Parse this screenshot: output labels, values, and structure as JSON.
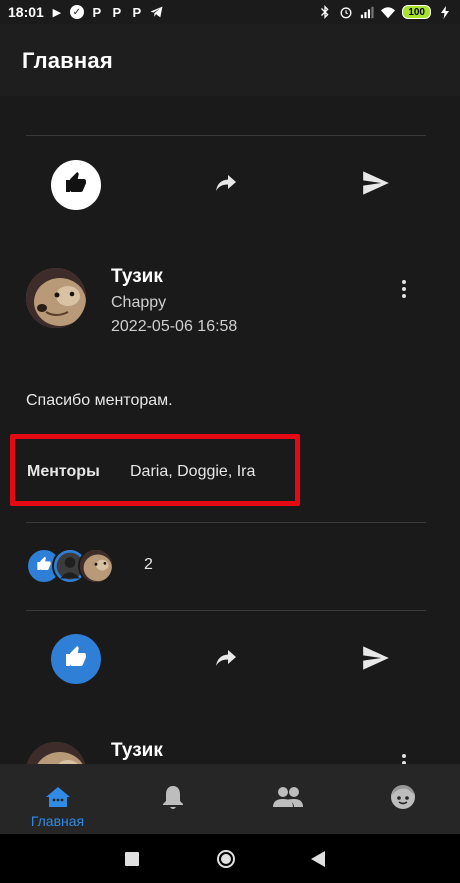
{
  "status_bar": {
    "time": "18:01",
    "notification_icons": [
      "play-icon",
      "check-circle-icon",
      "p-app-icon",
      "p-app-icon",
      "p-app-icon",
      "telegram-icon"
    ],
    "battery": "100"
  },
  "app_bar": {
    "title": "Главная"
  },
  "post1_actions": {
    "like_active": true
  },
  "post2": {
    "author": "Тузик",
    "subtitle": "Chappy",
    "timestamp": "2022-05-06 16:58",
    "text": "Спасибо менторам.",
    "mentors_label": "Менторы",
    "mentors_value": "Daria, Doggie, Ira",
    "likes_count": "2"
  },
  "post3": {
    "author": "Тузик"
  },
  "bottom_nav": {
    "items": [
      {
        "label": "Главная",
        "icon": "home-icon",
        "active": true
      },
      {
        "label": "",
        "icon": "bell-icon",
        "active": false
      },
      {
        "label": "",
        "icon": "people-icon",
        "active": false
      },
      {
        "label": "",
        "icon": "face-icon",
        "active": false
      }
    ]
  },
  "colors": {
    "accent": "#2f8be6",
    "highlight_box": "#e50914",
    "background": "#1a1a1a"
  }
}
